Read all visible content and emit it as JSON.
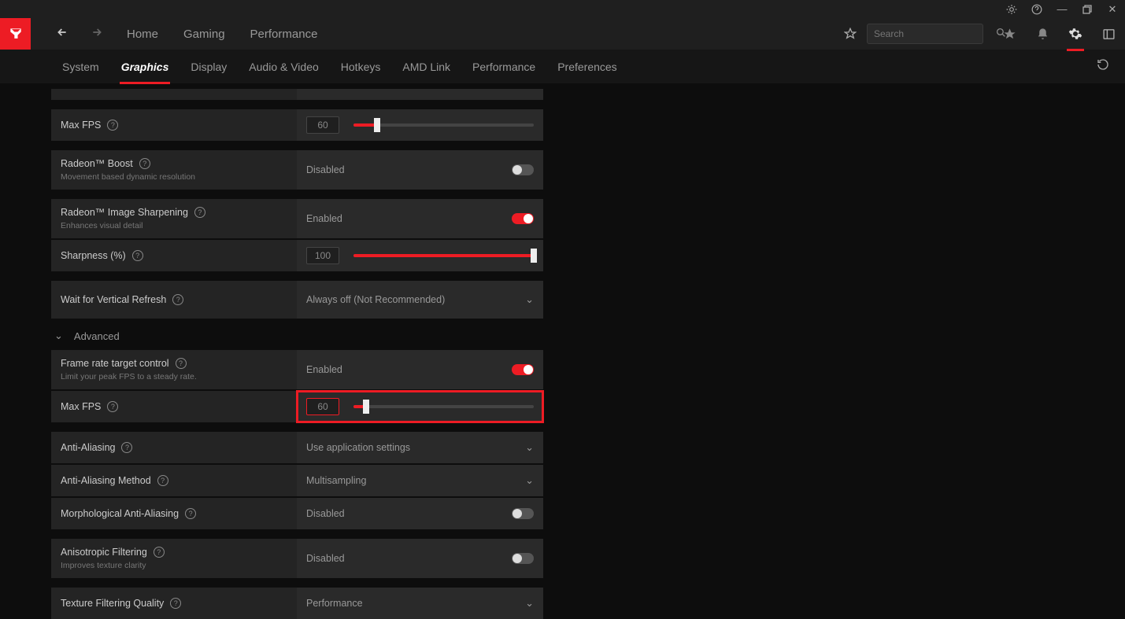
{
  "titlebar": {
    "bug": "⋇",
    "help": "?",
    "min": "—",
    "max": "▭",
    "close": "✕"
  },
  "mainnav": {
    "home": "Home",
    "gaming": "Gaming",
    "performance": "Performance",
    "search_placeholder": "Search"
  },
  "subnav": {
    "system": "System",
    "graphics": "Graphics",
    "display": "Display",
    "audio_video": "Audio & Video",
    "hotkeys": "Hotkeys",
    "amd_link": "AMD Link",
    "performance": "Performance",
    "preferences": "Preferences"
  },
  "rows": {
    "max_fps_1": {
      "label": "Max FPS",
      "value": "60"
    },
    "boost": {
      "label": "Radeon™ Boost",
      "sub": "Movement based dynamic resolution",
      "status": "Disabled"
    },
    "sharpening": {
      "label": "Radeon™ Image Sharpening",
      "sub": "Enhances visual detail",
      "status": "Enabled"
    },
    "sharpness": {
      "label": "Sharpness (%)",
      "value": "100"
    },
    "vsync": {
      "label": "Wait for Vertical Refresh",
      "value": "Always off (Not Recommended)"
    },
    "advanced": "Advanced",
    "frtc": {
      "label": "Frame rate target control",
      "sub": "Limit your peak FPS to a steady rate.",
      "status": "Enabled"
    },
    "max_fps_2": {
      "label": "Max FPS",
      "value": "60"
    },
    "aa": {
      "label": "Anti-Aliasing",
      "value": "Use application settings"
    },
    "aa_method": {
      "label": "Anti-Aliasing Method",
      "value": "Multisampling"
    },
    "morph_aa": {
      "label": "Morphological Anti-Aliasing",
      "status": "Disabled"
    },
    "aniso": {
      "label": "Anisotropic Filtering",
      "sub": "Improves texture clarity",
      "status": "Disabled"
    },
    "tex_quality": {
      "label": "Texture Filtering Quality",
      "value": "Performance"
    }
  }
}
